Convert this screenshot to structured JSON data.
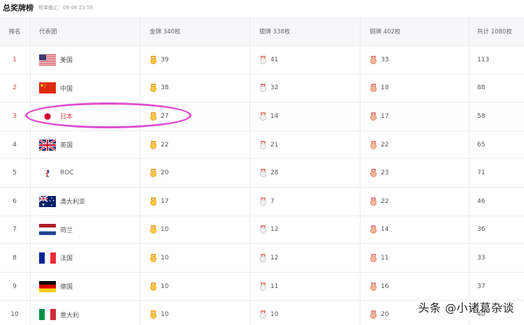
{
  "header": {
    "title": "总奖牌榜",
    "updated": "榜单截止：08-08 23:59"
  },
  "columns": {
    "rank": "排名",
    "team": "代表团",
    "gold": "金牌 340枚",
    "silver": "银牌 338枚",
    "bronze": "铜牌 402枚",
    "total": "共计 1080枚"
  },
  "rows": [
    {
      "rank": "1",
      "name": "美国",
      "flag": "flag-usa-icon",
      "gold": "39",
      "silver": "41",
      "bronze": "33",
      "total": "113"
    },
    {
      "rank": "2",
      "name": "中国",
      "flag": "flag-china-icon",
      "gold": "38",
      "silver": "32",
      "bronze": "18",
      "total": "88"
    },
    {
      "rank": "3",
      "name": "日本",
      "flag": "flag-japan-icon",
      "gold": "27",
      "silver": "14",
      "bronze": "17",
      "total": "58"
    },
    {
      "rank": "4",
      "name": "英国",
      "flag": "flag-uk-icon",
      "gold": "22",
      "silver": "21",
      "bronze": "22",
      "total": "65"
    },
    {
      "rank": "5",
      "name": "ROC",
      "flag": "roc-emblem-icon",
      "gold": "20",
      "silver": "28",
      "bronze": "23",
      "total": "71"
    },
    {
      "rank": "6",
      "name": "澳大利亚",
      "flag": "flag-australia-icon",
      "gold": "17",
      "silver": "7",
      "bronze": "22",
      "total": "46"
    },
    {
      "rank": "7",
      "name": "荷兰",
      "flag": "flag-netherlands-icon",
      "gold": "10",
      "silver": "12",
      "bronze": "14",
      "total": "36"
    },
    {
      "rank": "8",
      "name": "法国",
      "flag": "flag-france-icon",
      "gold": "10",
      "silver": "12",
      "bronze": "11",
      "total": "33"
    },
    {
      "rank": "9",
      "name": "德国",
      "flag": "flag-germany-icon",
      "gold": "10",
      "silver": "11",
      "bronze": "16",
      "total": "37"
    },
    {
      "rank": "10",
      "name": "意大利",
      "flag": "flag-italy-icon",
      "gold": "10",
      "silver": "10",
      "bronze": "20",
      "total": "40"
    }
  ],
  "highlight_color": "#e04bd1",
  "rank_accent_color": "#e04545",
  "watermark": "头条 @小诸葛杂谈"
}
